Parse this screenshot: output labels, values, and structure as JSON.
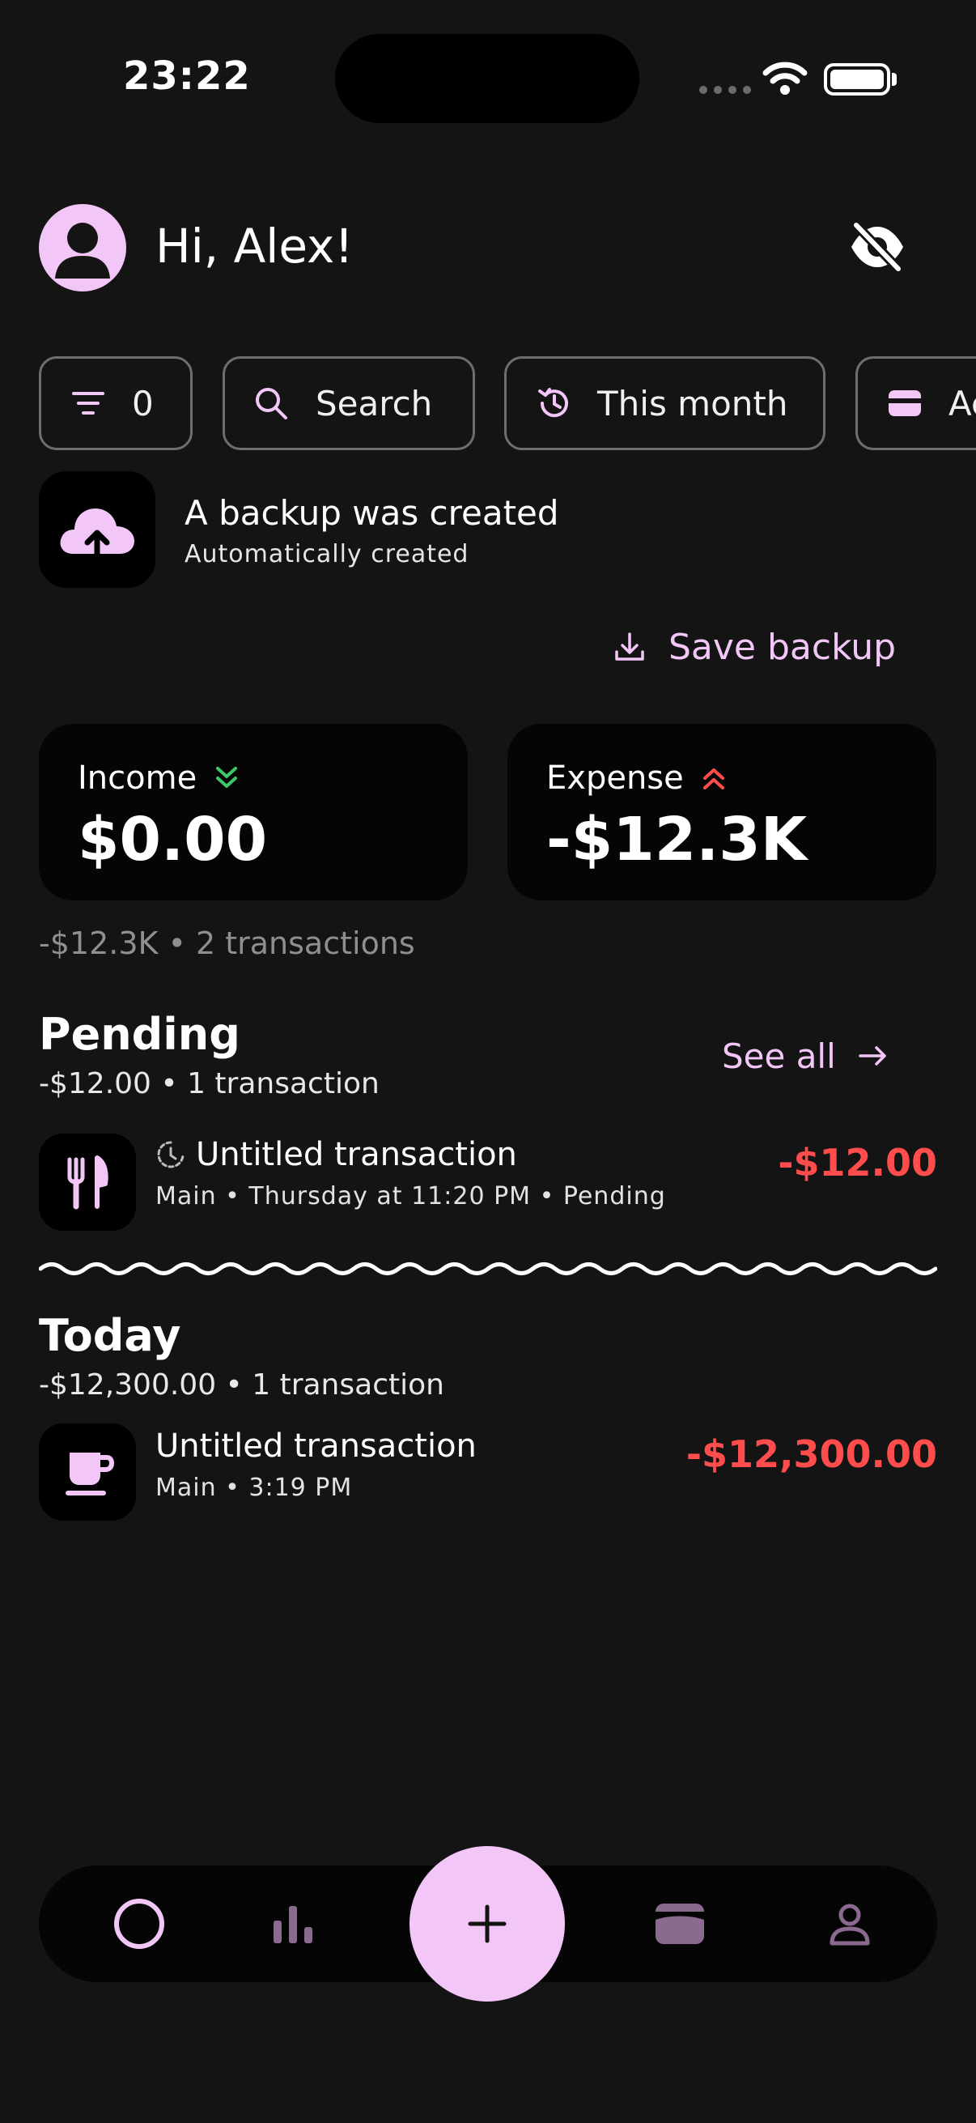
{
  "status_bar": {
    "time": "23:22"
  },
  "header": {
    "greeting": "Hi, Alex!"
  },
  "filters": {
    "count": "0",
    "search_label": "Search",
    "period_label": "This month",
    "accounts_label": "Ac"
  },
  "backup": {
    "title": "A backup was created",
    "subtitle": "Automatically created",
    "save_label": "Save backup"
  },
  "stats": {
    "income_label": "Income",
    "income_value": "$0.00",
    "expense_label": "Expense",
    "expense_value": "-$12.3K",
    "summary": "-$12.3K • 2 transactions"
  },
  "pending": {
    "title": "Pending",
    "subtitle": "-$12.00 • 1 transaction",
    "see_all": "See all",
    "transaction": {
      "title": "Untitled transaction",
      "meta": "Main • Thursday at 11:20 PM • Pending",
      "amount": "-$12.00",
      "icon": "utensils-icon"
    }
  },
  "today": {
    "title": "Today",
    "subtitle": "-$12,300.00 • 1 transaction",
    "transaction": {
      "title": "Untitled transaction",
      "meta": "Main • 3:19 PM",
      "amount": "-$12,300.00",
      "icon": "coffee-cup-icon"
    }
  },
  "colors": {
    "background": "#141414",
    "accent": "#f2c7f7",
    "income": "#3fc76a",
    "expense": "#ff4d4d"
  },
  "nav": {
    "items": [
      "home-icon",
      "stats-icon",
      "add-icon",
      "wallet-icon",
      "profile-icon"
    ]
  }
}
